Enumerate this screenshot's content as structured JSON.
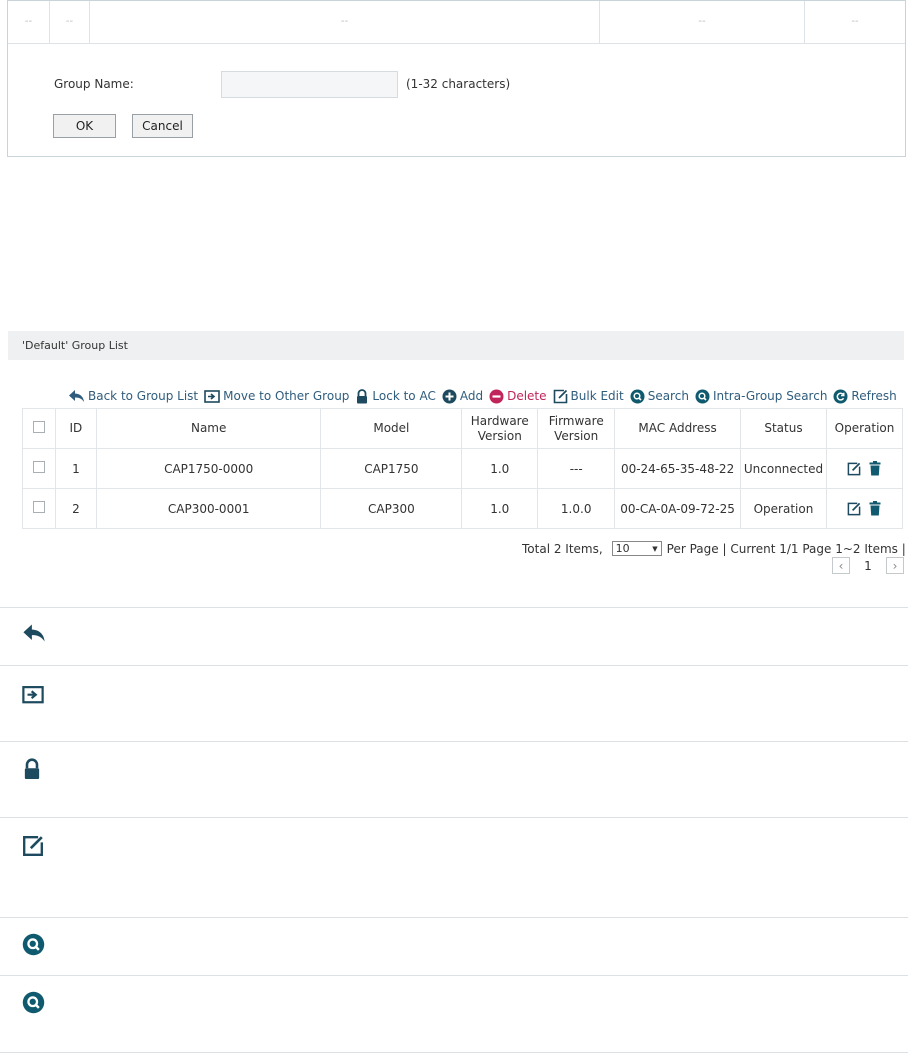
{
  "top_form": {
    "header_cells": [
      "--",
      "--",
      "--",
      "--",
      "--"
    ],
    "group_name_label": "Group Name:",
    "group_name_value": "",
    "group_name_hint": "(1-32 characters)",
    "ok_label": "OK",
    "cancel_label": "Cancel"
  },
  "group_list": {
    "title": "'Default' Group List",
    "toolbar": {
      "back": "Back to Group List",
      "move": "Move to Other Group",
      "lock": "Lock to AC",
      "add": "Add",
      "delete": "Delete",
      "bulk_edit": "Bulk Edit",
      "search": "Search",
      "intra_search": "Intra-Group Search",
      "refresh": "Refresh"
    },
    "columns": {
      "id": "ID",
      "name": "Name",
      "model": "Model",
      "hw1": "Hardware",
      "hw2": "Version",
      "fw1": "Firmware",
      "fw2": "Version",
      "mac": "MAC Address",
      "status": "Status",
      "operation": "Operation"
    },
    "rows": [
      {
        "id": "1",
        "name": "CAP1750-0000",
        "model": "CAP1750",
        "hw": "1.0",
        "fw": "---",
        "mac": "00-24-65-35-48-22",
        "status": "Unconnected"
      },
      {
        "id": "2",
        "name": "CAP300-0001",
        "model": "CAP300",
        "hw": "1.0",
        "fw": "1.0.0",
        "mac": "00-CA-0A-09-72-25",
        "status": "Operation"
      }
    ],
    "pager": {
      "total": "Total 2 Items,",
      "per_page_value": "10",
      "per_page_label": "Per Page | Current 1/1 Page 1~2 Items |",
      "page_number": "1"
    }
  },
  "colors": {
    "accent": "#0f5a6e",
    "toolbar_text": "#2f5d7d",
    "delete": "#c0245a"
  },
  "legend_icons": [
    "back-icon",
    "move-icon",
    "lock-icon",
    "edit-icon",
    "search-icon",
    "intra-search-icon"
  ]
}
